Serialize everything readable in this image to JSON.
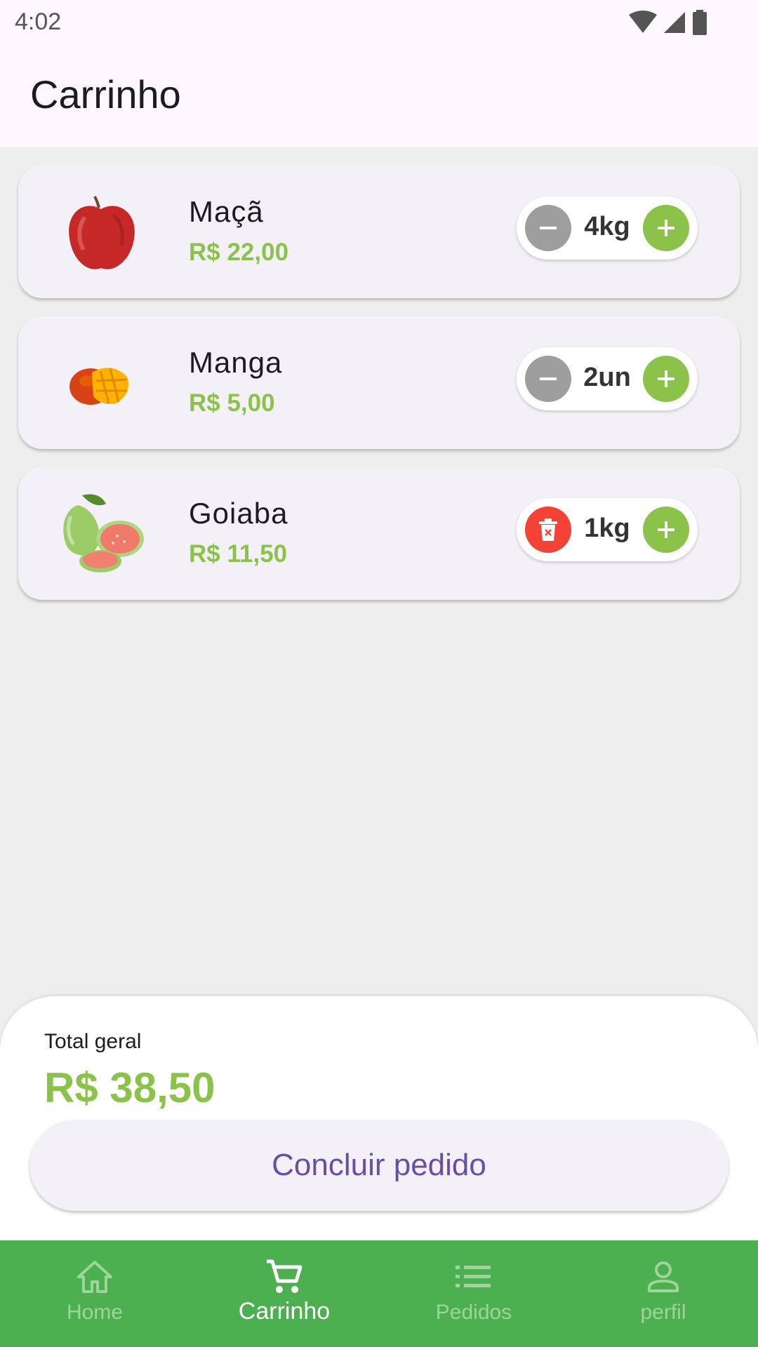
{
  "status_bar": {
    "time": "4:02"
  },
  "app_bar": {
    "title": "Carrinho"
  },
  "cart": {
    "items": [
      {
        "name": "Maçã",
        "price": "R$ 22,00",
        "quantity": "4kg",
        "left_action": "decrease",
        "image": "apple"
      },
      {
        "name": "Manga",
        "price": "R$ 5,00",
        "quantity": "2un",
        "left_action": "decrease",
        "image": "mango"
      },
      {
        "name": "Goiaba",
        "price": "R$ 11,50",
        "quantity": "1kg",
        "left_action": "delete",
        "image": "guava"
      }
    ]
  },
  "summary": {
    "total_label": "Total geral",
    "total_value": "R$ 38,50",
    "checkout_label": "Concluir pedido"
  },
  "bottom_nav": {
    "items": [
      {
        "label": "Home",
        "icon": "home-icon",
        "active": false
      },
      {
        "label": "Carrinho",
        "icon": "cart-icon",
        "active": true
      },
      {
        "label": "Pedidos",
        "icon": "list-icon",
        "active": false
      },
      {
        "label": "perfil",
        "icon": "person-icon",
        "active": false
      }
    ]
  },
  "colors": {
    "accent_green": "#8bc34a",
    "nav_green": "#4caf50",
    "primary_purple": "#6750a4",
    "delete_red": "#f44336",
    "decrease_grey": "#9e9e9e"
  }
}
